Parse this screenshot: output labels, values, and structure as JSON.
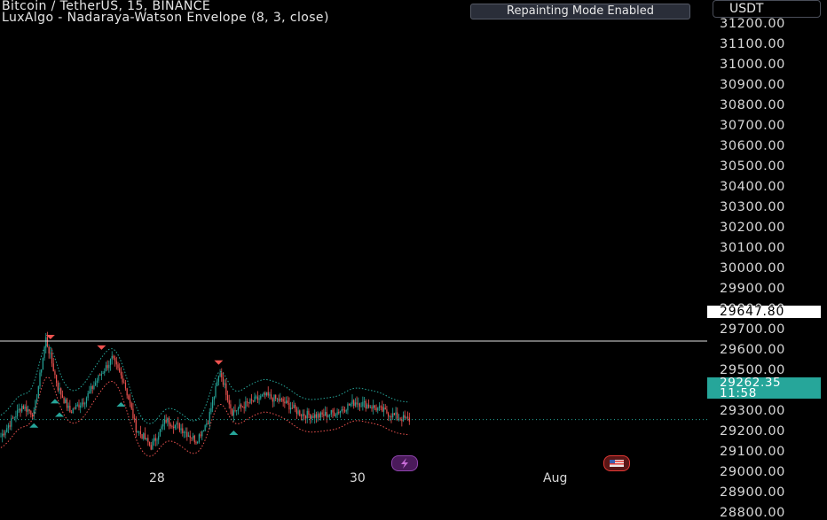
{
  "header": {
    "symbol_line": "Bitcoin / TetherUS, 15, BINANCE",
    "indicator_line": "LuxAlgo - Nadaraya-Watson Envelope (8, 3, close)",
    "badge": "Repainting Mode Enabled",
    "currency": "USDT"
  },
  "colors": {
    "background": "#000000",
    "up": "#26a69a",
    "down": "#ef5350",
    "text": "#d1d4dc"
  },
  "price_labels": {
    "horizontal_line": "29647.80",
    "last_price": "29262.35",
    "countdown": "11:58",
    "last_price_hidden_text": "29200.00"
  },
  "event_icons": [
    {
      "name": "lightning-icon",
      "color": "#9c27b0"
    },
    {
      "name": "us-flag-icon",
      "color": "#e53935"
    }
  ],
  "chart_data": {
    "type": "candlestick",
    "title": "Bitcoin / TetherUS, 15, BINANCE",
    "indicator": "LuxAlgo - Nadaraya-Watson Envelope (8, 3, close)",
    "ylim": [
      28800,
      31250
    ],
    "y_ticks": [
      "31200.00",
      "31100.00",
      "31000.00",
      "30900.00",
      "30800.00",
      "30700.00",
      "30600.00",
      "30500.00",
      "30400.00",
      "30300.00",
      "30200.00",
      "30100.00",
      "30000.00",
      "29900.00",
      "29800.00",
      "29700.00",
      "29600.00",
      "29500.00",
      "29400.00",
      "29300.00",
      "29200.00",
      "29100.00",
      "29000.00",
      "28900.00",
      "28800.00"
    ],
    "x_ticks": [
      "28",
      "30",
      "Aug"
    ],
    "horizontal_line": 29647.8,
    "last_price": 29262.35,
    "price_path_anchors": [
      {
        "i": 0,
        "price": 29180
      },
      {
        "i": 14,
        "price": 29330
      },
      {
        "i": 22,
        "price": 29290
      },
      {
        "i": 30,
        "price": 29660
      },
      {
        "i": 38,
        "price": 29420
      },
      {
        "i": 46,
        "price": 29300
      },
      {
        "i": 56,
        "price": 29360
      },
      {
        "i": 66,
        "price": 29480
      },
      {
        "i": 74,
        "price": 29560
      },
      {
        "i": 82,
        "price": 29450
      },
      {
        "i": 90,
        "price": 29220
      },
      {
        "i": 100,
        "price": 29130
      },
      {
        "i": 110,
        "price": 29260
      },
      {
        "i": 120,
        "price": 29220
      },
      {
        "i": 130,
        "price": 29160
      },
      {
        "i": 138,
        "price": 29260
      },
      {
        "i": 146,
        "price": 29500
      },
      {
        "i": 154,
        "price": 29300
      },
      {
        "i": 164,
        "price": 29340
      },
      {
        "i": 176,
        "price": 29380
      },
      {
        "i": 188,
        "price": 29350
      },
      {
        "i": 200,
        "price": 29290
      },
      {
        "i": 212,
        "price": 29280
      },
      {
        "i": 224,
        "price": 29300
      },
      {
        "i": 236,
        "price": 29350
      },
      {
        "i": 246,
        "price": 29330
      },
      {
        "i": 256,
        "price": 29300
      },
      {
        "i": 266,
        "price": 29270
      },
      {
        "i": 272,
        "price": 29262
      }
    ],
    "candle_count": 273,
    "envelope_width": 80,
    "sell_signals_at_index": [
      33,
      67,
      145
    ],
    "buy_signals_at_index": [
      22,
      36,
      39,
      80,
      155
    ]
  }
}
